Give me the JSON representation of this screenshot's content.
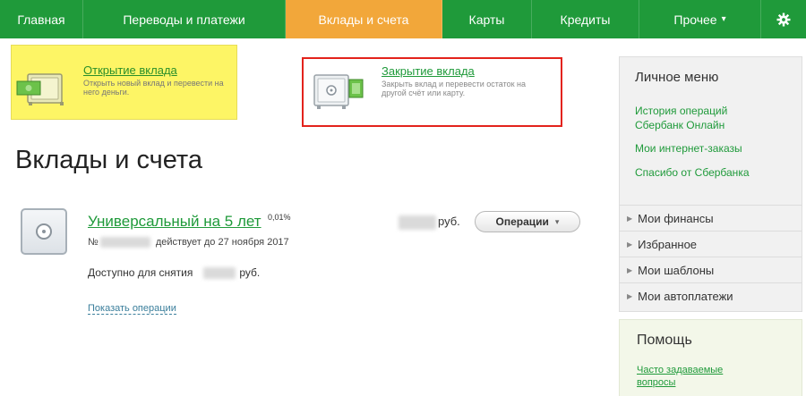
{
  "nav": {
    "items": [
      {
        "label": "Главная"
      },
      {
        "label": "Переводы и платежи"
      },
      {
        "label": "Вклады и счета"
      },
      {
        "label": "Карты"
      },
      {
        "label": "Кредиты"
      },
      {
        "label": "Прочее"
      }
    ],
    "caret": "▾"
  },
  "banners": {
    "open": {
      "title": "Открытие вклада",
      "desc": "Открыть новый вклад и перевести на него деньги."
    },
    "close": {
      "title": "Закрытие вклада",
      "desc": "Закрыть вклад и перевести остаток на другой счёт или карту."
    }
  },
  "page": {
    "title": "Вклады и счета"
  },
  "deposit": {
    "name": "Универсальный на 5 лет",
    "rate": "0,01%",
    "number_prefix": "№",
    "valid": "действует до 27 ноября 2017",
    "currency": "руб.",
    "operations_label": "Операции",
    "available_label": "Доступно для снятия",
    "show_operations": "Показать операции"
  },
  "sidebar": {
    "title": "Личное меню",
    "links": [
      "История операций Сбербанк Онлайн",
      "Мои интернет-заказы",
      "Спасибо от Сбербанка"
    ],
    "sections": [
      "Мои финансы",
      "Избранное",
      "Мои шаблоны",
      "Мои автоплатежи"
    ]
  },
  "help": {
    "title": "Помощь",
    "link": "Часто задаваемые вопросы"
  },
  "colors": {
    "brand_green": "#1f9a3a",
    "active_tab": "#f2a73a",
    "highlight_red": "#e3231c",
    "banner_yellow": "#fdf565"
  }
}
